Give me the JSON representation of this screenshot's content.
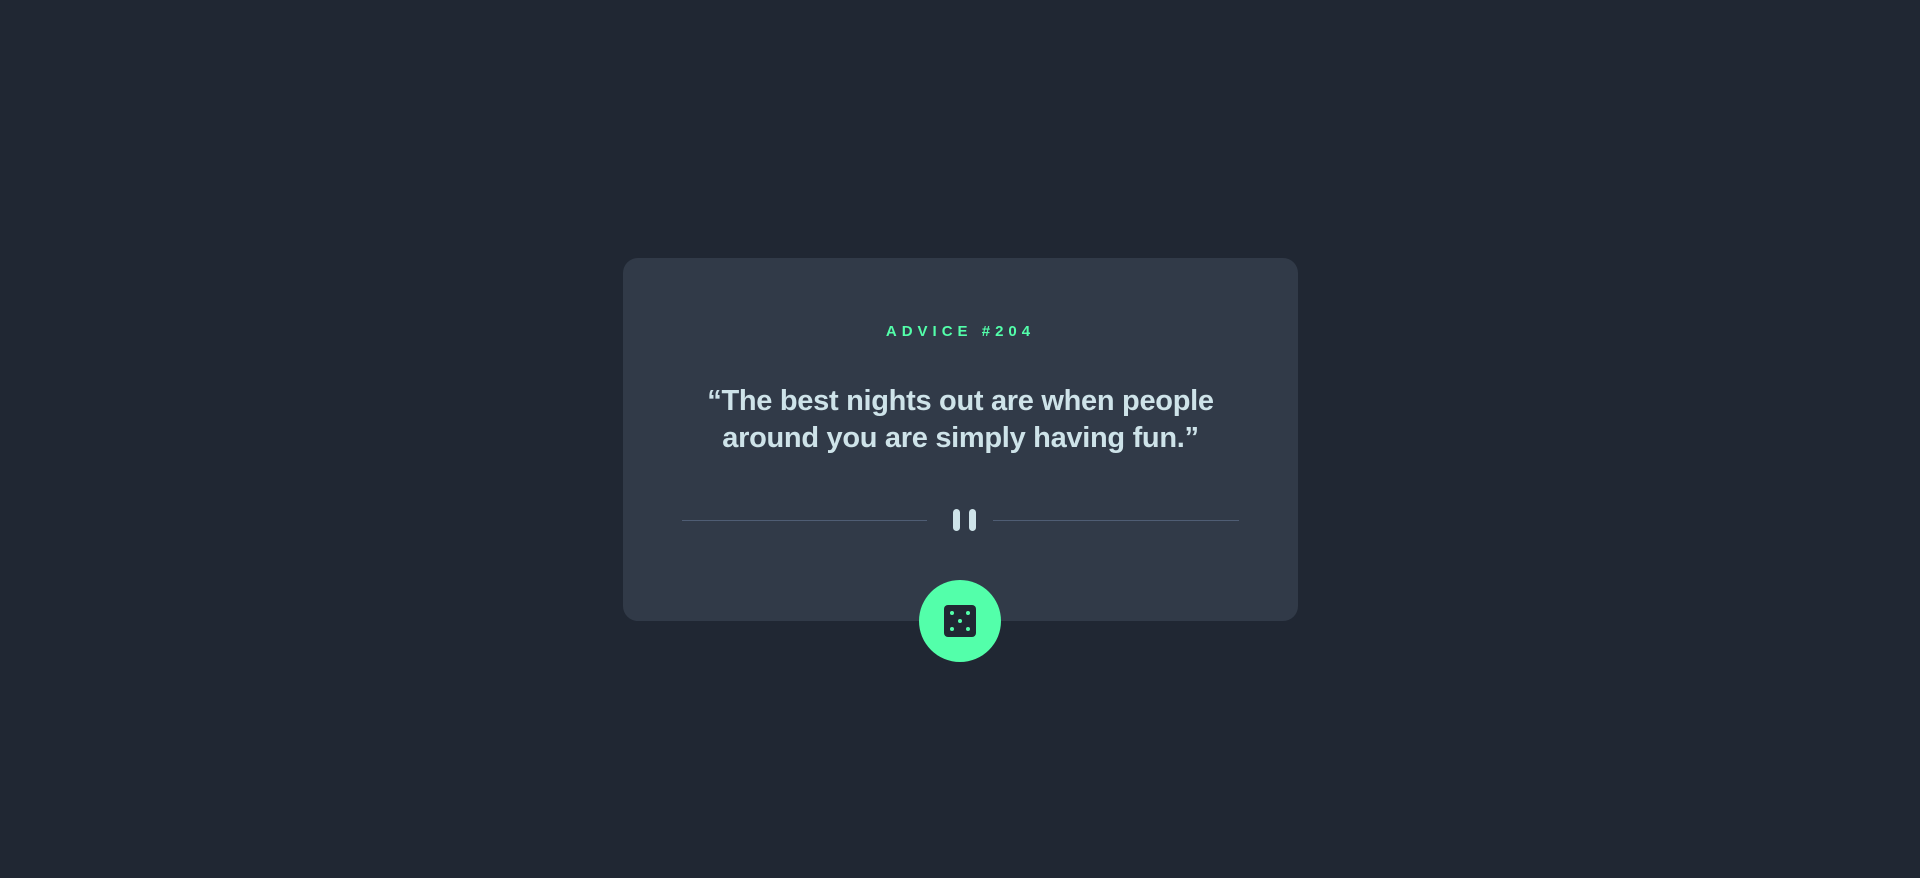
{
  "advice": {
    "label": "ADVICE #204",
    "quote": "“The best nights out are when people around you are simply having fun.”"
  },
  "divider": {
    "icon": "pause-icon"
  },
  "dice_button": {
    "icon": "dice-icon"
  },
  "colors": {
    "background": "#202733",
    "card": "#313a48",
    "accent": "#53ffaa",
    "text": "#cee3e9",
    "divider_line": "#4f5d74"
  }
}
